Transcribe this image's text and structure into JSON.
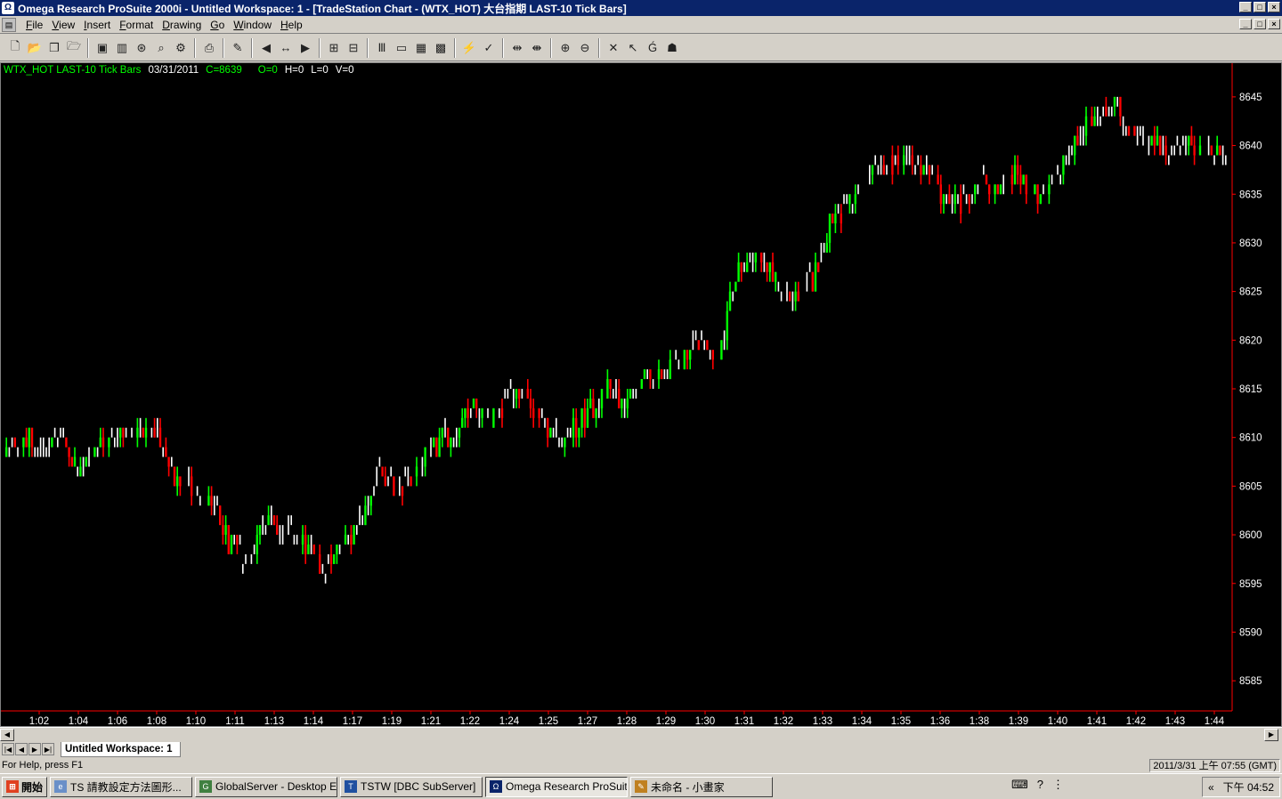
{
  "window": {
    "title": "Omega Research ProSuite 2000i - Untitled Workspace:  1 - [TradeStation Chart - (WTX_HOT) 大台指期 LAST-10 Tick Bars]"
  },
  "menu": {
    "items": [
      {
        "label": "File",
        "key": "F",
        "rest": "ile"
      },
      {
        "label": "View",
        "key": "V",
        "rest": "iew"
      },
      {
        "label": "Insert",
        "key": "I",
        "rest": "nsert"
      },
      {
        "label": "Format",
        "key": "F",
        "rest": "ormat"
      },
      {
        "label": "Drawing",
        "key": "D",
        "rest": "rawing"
      },
      {
        "label": "Go",
        "key": "G",
        "rest": "o"
      },
      {
        "label": "Window",
        "key": "W",
        "rest": "indow"
      },
      {
        "label": "Help",
        "key": "H",
        "rest": "elp"
      }
    ]
  },
  "chart_header": {
    "symbol": "WTX_HOT LAST-10 Tick Bars",
    "date": "03/31/2011",
    "close": "C=8639",
    "open": "O=0",
    "high": "H=0",
    "low": "L=0",
    "volume": "V=0"
  },
  "chart_data": {
    "type": "ohlc",
    "colors": {
      "up": "#00ff00",
      "down": "#ff0000",
      "flat": "#ffffff",
      "axis": "#ff0000",
      "background": "#000000"
    },
    "ylim": [
      8583,
      8647
    ],
    "y_ticks": [
      8645,
      8640,
      8635,
      8630,
      8625,
      8620,
      8615,
      8610,
      8605,
      8600,
      8595,
      8590,
      8585
    ],
    "x_ticks": [
      "1:02",
      "1:04",
      "1:06",
      "1:08",
      "1:10",
      "1:11",
      "1:13",
      "1:14",
      "1:17",
      "1:19",
      "1:21",
      "1:22",
      "1:24",
      "1:25",
      "1:27",
      "1:28",
      "1:29",
      "1:30",
      "1:31",
      "1:32",
      "1:33",
      "1:34",
      "1:35",
      "1:36",
      "1:38",
      "1:39",
      "1:40",
      "1:41",
      "1:42",
      "1:43",
      "1:44"
    ],
    "close_path": [
      8608,
      8610,
      8609,
      8610,
      8607,
      8609,
      8611,
      8610,
      8611,
      8606,
      8605,
      8603,
      8599,
      8598,
      8602,
      8600,
      8599,
      8596,
      8599,
      8602,
      8606,
      8604,
      8607,
      8609,
      8611,
      8613,
      8612,
      8615,
      8614,
      8611,
      8610,
      8612,
      8615,
      8614,
      8616,
      8616,
      8618,
      8620,
      8618,
      8627,
      8629,
      8626,
      8624,
      8626,
      8632,
      8634,
      8637,
      8638,
      8639,
      8637,
      8635,
      8634,
      8636,
      8635,
      8637,
      8634,
      8637,
      8640,
      8643,
      8645,
      8641,
      8640,
      8640,
      8640,
      8639,
      8639
    ]
  },
  "workspace_tab": "Untitled Workspace:  1",
  "status": {
    "help": "For Help, press F1",
    "datetime": "2011/3/31 上午 07:55 (GMT)"
  },
  "taskbar": {
    "start": "開始",
    "tasks": [
      {
        "label": "TS 請教設定方法圖形...",
        "active": false
      },
      {
        "label": "GlobalServer - Desktop E...",
        "active": false
      },
      {
        "label": "TSTW [DBC SubServer]",
        "active": false
      },
      {
        "label": "Omega Research ProSuit...",
        "active": true
      },
      {
        "label": "未命名 - 小畫家",
        "active": false
      }
    ],
    "clock": "下午 04:52"
  }
}
